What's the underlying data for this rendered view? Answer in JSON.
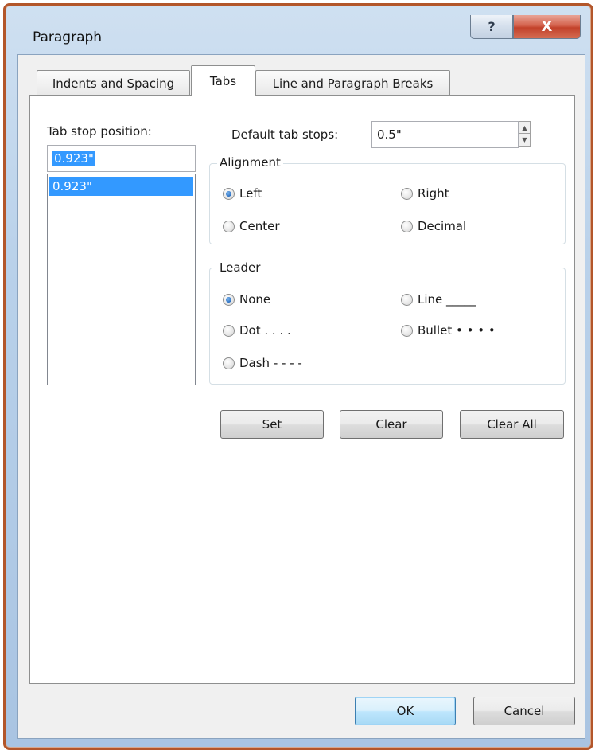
{
  "window": {
    "title": "Paragraph",
    "help_label": "?",
    "close_label": "X"
  },
  "tabs": [
    {
      "label": "Indents and Spacing",
      "active": false
    },
    {
      "label": "Tabs",
      "active": true
    },
    {
      "label": "Line and Paragraph Breaks",
      "active": false
    }
  ],
  "tab_stop": {
    "label": "Tab stop position:",
    "value": "0.923\"",
    "list": [
      "0.923\""
    ]
  },
  "default_tab_stops": {
    "label": "Default tab stops:",
    "value": "0.5\""
  },
  "alignment": {
    "title": "Alignment",
    "options": [
      {
        "label": "Left",
        "checked": true
      },
      {
        "label": "Right",
        "checked": false
      },
      {
        "label": "Center",
        "checked": false
      },
      {
        "label": "Decimal",
        "checked": false
      }
    ]
  },
  "leader": {
    "title": "Leader",
    "options": [
      {
        "label": "None",
        "checked": true
      },
      {
        "label": "Line _____",
        "checked": false
      },
      {
        "label": "Dot . . . .",
        "checked": false
      },
      {
        "label": "Bullet • • • •",
        "checked": false
      },
      {
        "label": "Dash - - - -",
        "checked": false
      }
    ]
  },
  "actions": {
    "set": "Set",
    "clear": "Clear",
    "clear_all": "Clear All"
  },
  "footer": {
    "ok": "OK",
    "cancel": "Cancel"
  },
  "colors": {
    "frame_accent": "#b3562a",
    "selection": "#3399ff",
    "close_button": "#c2412a"
  }
}
